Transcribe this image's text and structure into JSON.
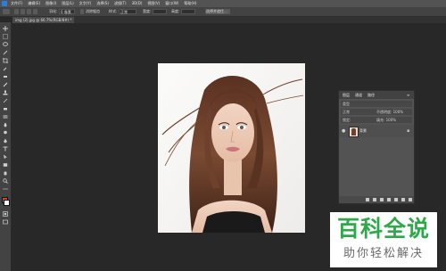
{
  "app": {
    "name": "Adobe Photoshop",
    "logo": "ps-logo"
  },
  "menu": [
    "文件(F)",
    "编辑(E)",
    "图像(I)",
    "图层(L)",
    "文字(Y)",
    "选择(S)",
    "滤镜(T)",
    "3D(D)",
    "视图(V)",
    "窗口(W)",
    "帮助(H)"
  ],
  "options": {
    "feather_label": "羽化:",
    "feather_value": "0 像素",
    "antialias_label": "消除锯齿",
    "style_label": "样式:",
    "style_value": "正常",
    "width_label": "宽度:",
    "height_label": "高度:",
    "select_mask_label": "选择并遮住..."
  },
  "document": {
    "tab_title": "img (2).jpg @ 66.7%(RGB/8#) *"
  },
  "layers_panel": {
    "tabs": [
      "图层",
      "通道",
      "路径"
    ],
    "kind_label": "类型",
    "mode_label": "正常",
    "opacity_label": "不透明度: 100%",
    "lock_label": "锁定:",
    "fill_label": "填充: 100%",
    "layer_name": "背景"
  },
  "colors": {
    "foreground": "#e8401a",
    "background": "#ffffff",
    "accent": "#2ea84a"
  },
  "watermark": {
    "title": "百科全说",
    "subtitle": "助你轻松解决"
  }
}
